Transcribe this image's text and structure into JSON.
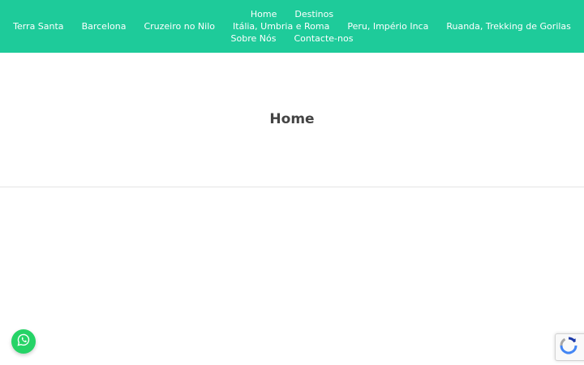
{
  "nav": {
    "row1": [
      {
        "label": "Home"
      },
      {
        "label": "Destinos"
      }
    ],
    "row2": [
      {
        "label": "Terra Santa"
      },
      {
        "label": "Barcelona"
      },
      {
        "label": "Cruzeiro no Nilo"
      },
      {
        "label": "Itália, Umbria e Roma"
      },
      {
        "label": "Peru, Império Inca"
      },
      {
        "label": "Ruanda, Trekking de Gorilas"
      }
    ],
    "row3": [
      {
        "label": "Sobre Nós"
      },
      {
        "label": "Contacte-nos"
      }
    ]
  },
  "page": {
    "title": "Home"
  },
  "widgets": {
    "whatsapp_icon": "whatsapp-icon",
    "whatsapp_color": "#25d366",
    "recaptcha_icon": "recaptcha-icon"
  },
  "colors": {
    "header_bg": "#1ecb9a",
    "nav_text": "#ffffff",
    "title_text": "#444444"
  }
}
